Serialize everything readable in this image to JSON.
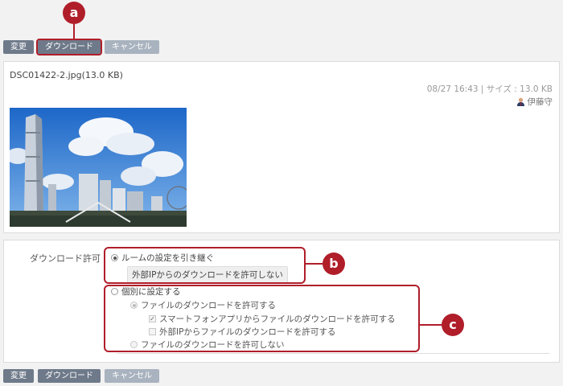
{
  "top_toolbar": {
    "change": "変更",
    "download": "ダウンロード",
    "cancel": "キャンセル"
  },
  "file": {
    "name": "DSC01422-2.jpg(13.0 KB)",
    "meta": "08/27 16:43 | サイズ : 13.0 KB",
    "author": "伊藤守"
  },
  "permission": {
    "label": "ダウンロード許可 :",
    "inherit": "ルームの設定を引き継ぐ",
    "inherit_value": "外部IPからのダウンロードを許可しない",
    "individual": "個別に設定する",
    "allow": "ファイルのダウンロードを許可する",
    "allow_smartphone": "スマートフォンアプリからファイルのダウンロードを許可する",
    "allow_external_ip": "外部IPからファイルのダウンロードを許可する",
    "deny": "ファイルのダウンロードを許可しない"
  },
  "bottom_toolbar": {
    "change": "変更",
    "download": "ダウンロード",
    "cancel": "キャンセル"
  },
  "callouts": {
    "a": "a",
    "b": "b",
    "c": "c"
  },
  "colors": {
    "accent": "#b01e2a",
    "button": "#6e7a8a",
    "button_disabled": "#a9b3bf"
  }
}
